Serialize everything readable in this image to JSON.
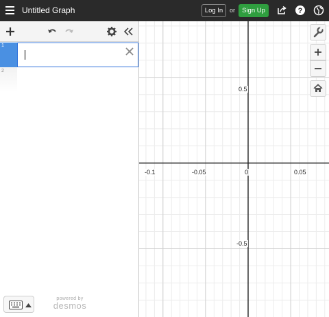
{
  "header": {
    "title": "Untitled Graph",
    "login_label": "Log In",
    "or_text": "or",
    "signup_label": "Sign Up",
    "signup_color": "#2f9e3f",
    "background": "#2a2a2a",
    "icons": [
      "menu-icon",
      "share-icon",
      "help-icon",
      "globe-icon"
    ]
  },
  "toolbar": {
    "icons": [
      "plus-icon",
      "undo-icon",
      "redo-icon",
      "settings-gear-icon",
      "collapse-chevrons-icon"
    ]
  },
  "expressions": [
    {
      "index": "1",
      "value": "",
      "active": true
    },
    {
      "index": "2",
      "value": "",
      "active": false
    }
  ],
  "footer": {
    "powered_by": "powered by",
    "brand": "desmos"
  },
  "graph": {
    "x_tick_labels": [
      "-0.1",
      "-0.05",
      "0",
      "0.05"
    ],
    "y_tick_labels": [
      "0.5",
      "-0.5"
    ],
    "x_range": [
      -0.128,
      0.095
    ],
    "y_range": [
      -0.8985,
      0.8275
    ],
    "major_step_x": 0.05,
    "minor_step_x": 0.01,
    "major_step_y": 0.5,
    "minor_step_y": 0.1,
    "grid": true
  },
  "graph_controls": {
    "icons": [
      "wrench-icon",
      "zoom-in-icon",
      "zoom-out-icon",
      "home-icon"
    ]
  }
}
